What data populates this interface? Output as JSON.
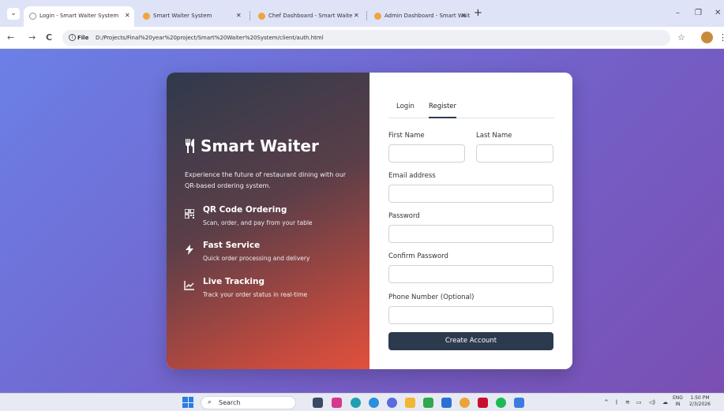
{
  "browser": {
    "tabs": [
      {
        "title": "Login - Smart Waiter System",
        "active": true
      },
      {
        "title": "Smart Waiter System",
        "active": false
      },
      {
        "title": "Chef Dashboard - Smart Waite",
        "active": false
      },
      {
        "title": "Admin Dashboard - Smart Wait",
        "active": false
      }
    ],
    "new_tab": "+",
    "file_label": "File",
    "url": "D:/Projects/Final%20year%20project/Smart%20Waiter%20System/client/auth.html"
  },
  "left_panel": {
    "brand": "Smart Waiter",
    "brand_icon": "utensils-icon",
    "description": "Experience the future of restaurant dining with our QR-based ordering system.",
    "features": [
      {
        "icon": "qr-code-icon",
        "title": "QR Code Ordering",
        "description": "Scan, order, and pay from your table"
      },
      {
        "icon": "bolt-icon",
        "title": "Fast Service",
        "description": "Quick order processing and delivery"
      },
      {
        "icon": "chart-line-icon",
        "title": "Live Tracking",
        "description": "Track your order status in real-time"
      }
    ]
  },
  "auth": {
    "tabs": {
      "login": "Login",
      "register": "Register"
    },
    "active_tab": "Register",
    "fields": {
      "first_name": {
        "label": "First Name",
        "value": ""
      },
      "last_name": {
        "label": "Last Name",
        "value": ""
      },
      "email": {
        "label": "Email address",
        "value": ""
      },
      "password": {
        "label": "Password",
        "value": ""
      },
      "confirm_password": {
        "label": "Confirm Password",
        "value": ""
      },
      "phone": {
        "label": "Phone Number (Optional)",
        "value": ""
      }
    },
    "submit_label": "Create Account"
  },
  "taskbar": {
    "search_label": "Search",
    "language": "ENG",
    "region": "IN",
    "time": "1:50 PM",
    "date": "2/3/2026"
  },
  "colors": {
    "page_gradient_start": "#6b80e6",
    "page_gradient_end": "#7a4fb3",
    "panel_dark": "#2f3a4c",
    "panel_red": "#e0513c",
    "button": "#2c3a4e"
  }
}
